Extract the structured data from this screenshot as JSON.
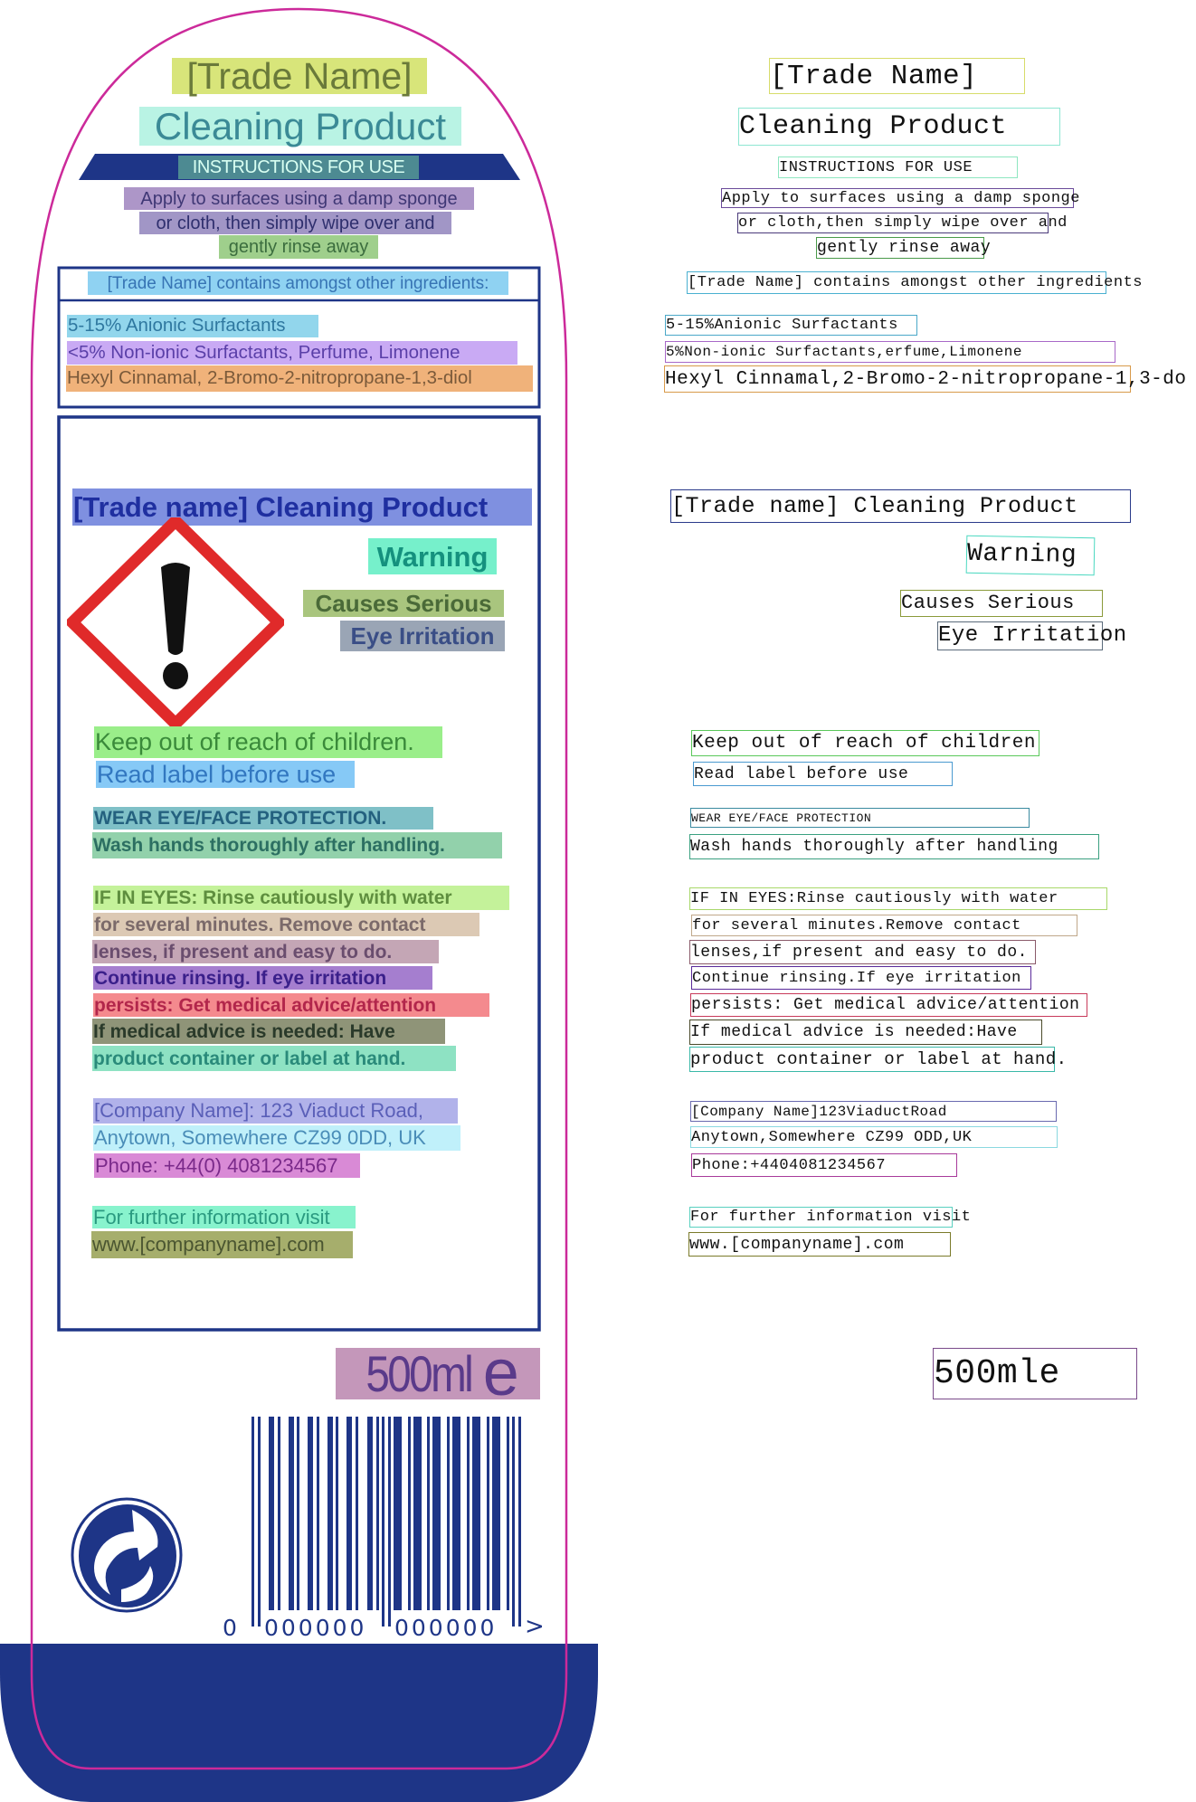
{
  "label": {
    "trade_name": "[Trade Name]",
    "product_name": "Cleaning Product",
    "instructions_banner": "INSTRUCTIONS FOR USE",
    "instructions": [
      "Apply to surfaces using a damp sponge",
      "or cloth, then simply wipe over and",
      "gently rinse away"
    ],
    "ingredients_header": "[Trade Name] contains amongst other ingredients:",
    "ingredients": [
      "5-15% Anionic Surfactants",
      "<5% Non-ionic Surfactants, Perfume, Limonene",
      "Hexyl Cinnamal, 2-Bromo-2-nitropropane-1,3-diol"
    ],
    "safety": {
      "title": "[Trade name] Cleaning Product",
      "signal_word": "Warning",
      "hazard": [
        "Causes Serious",
        "Eye Irritation"
      ],
      "hazard_icon": "exclamation-mark-pictogram",
      "precautions_general": [
        "Keep out of reach of children.",
        "Read label before use"
      ],
      "precautions_ppe": [
        "WEAR EYE/FACE PROTECTION.",
        "Wash hands thoroughly after handling."
      ],
      "first_aid": [
        "IF IN EYES: Rinse cautiously with water",
        "for several minutes. Remove contact",
        "lenses, if present and easy to do.",
        "Continue rinsing. If eye irritation",
        "persists: Get medical advice/attention",
        "If medical advice is needed: Have",
        "product container or label at hand."
      ],
      "company": [
        "[Company Name]: 123 Viaduct Road,",
        "Anytown, Somewhere CZ99 0DD, UK",
        "Phone: +44(0) 4081234567"
      ],
      "info": [
        "For further information visit",
        "www.[companyname].com"
      ]
    },
    "volume": "500ml",
    "estimated_sign": "e",
    "barcode": {
      "lead_digit": "0",
      "group1": "000000",
      "group2": "000000",
      "end_mark": ">"
    },
    "recycle_icon": "green-dot-icon"
  },
  "ocr": {
    "lines": [
      "[Trade Name]",
      "Cleaning Product",
      "INSTRUCTIONS FOR USE",
      "Apply to surfaces using a damp sponge",
      "or cloth,then simply wipe over and",
      "gently rinse away",
      "[Trade Name] contains amongst other ingredients",
      "5-15%Anionic Surfactants",
      "5%Non-ionic Surfactants,erfume,Limonene",
      "Hexyl Cinnamal,2-Bromo-2-nitropropane-1,3-do",
      "[Trade name] Cleaning Product",
      "Warning",
      "Causes Serious",
      "Eye Irritation",
      "Keep out of reach of children",
      "Read label before use",
      "WEAR EYE/FACE PROTECTION",
      "Wash hands thoroughly after handling",
      "IF IN EYES:Rinse cautiously with water",
      "for several minutes.Remove contact",
      "lenses,if present and easy to do.",
      "Continue rinsing.If eye irritation",
      "persists: Get medical advice/attention",
      "If medical advice is needed:Have",
      "product container or label at hand.",
      "[Company Name]123ViaductRoad",
      "Anytown,Somewhere CZ99 ODD,UK",
      "Phone:+4404081234567",
      "For further information visit",
      "www.[companyname].com",
      "500mle"
    ]
  },
  "colors": {
    "brand_navy": "#1e3587",
    "outline_magenta": "#cc2a9a",
    "hazard_red": "#e02a2a"
  }
}
